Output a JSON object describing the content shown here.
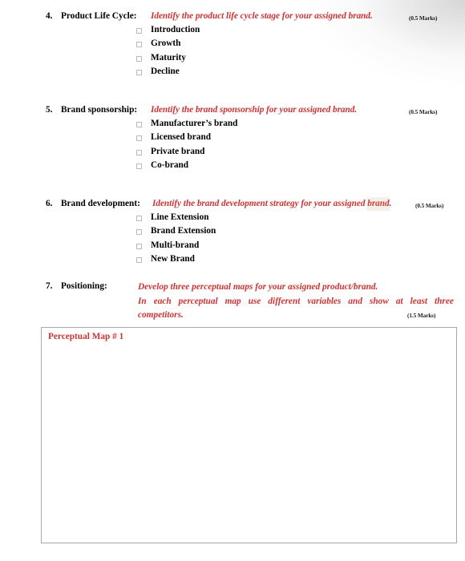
{
  "document": {
    "type": "assignment-worksheet",
    "accent_red": "#CC3333",
    "text_black": "#000000",
    "box_border": "#a8a8a8",
    "checkbox_border": "#b9b9b9"
  },
  "sections": [
    {
      "number": "4.",
      "label": "Product Life Cycle:",
      "instruction": "Identify the product life cycle stage for your assigned brand.",
      "marks": "(0.5 Marks)",
      "options": [
        {
          "label": "Introduction",
          "checked": false
        },
        {
          "label": "Growth",
          "checked": false
        },
        {
          "label": "Maturity",
          "checked": false
        },
        {
          "label": "Decline",
          "checked": false
        }
      ]
    },
    {
      "number": "5.",
      "label": "Brand sponsorship:",
      "instruction": "Identify the brand sponsorship for your assigned brand.",
      "marks": "(0.5 Marks)",
      "options": [
        {
          "label": "Manufacturer’s brand",
          "checked": false
        },
        {
          "label": "Licensed brand",
          "checked": false
        },
        {
          "label": "Private brand",
          "checked": false
        },
        {
          "label": "Co-brand",
          "checked": false
        }
      ]
    },
    {
      "number": "6.",
      "label": "Brand development:",
      "instruction_pre": "Identify the brand development strategy for your assigned ",
      "instruction_marked": "brand",
      "instruction_post": ".",
      "marks": "(0.5 Marks)",
      "options": [
        {
          "label": "Line Extension",
          "checked": false
        },
        {
          "label": "Brand Extension",
          "checked": false
        },
        {
          "label": "Multi-brand",
          "checked": false
        },
        {
          "label": "New Brand",
          "checked": false
        }
      ]
    },
    {
      "number": "7.",
      "label": "Positioning:",
      "marks": "(1.5 Marks)",
      "paragraph": {
        "line1": "Develop three perceptual maps for your assigned product/brand.",
        "line2_words": [
          "In",
          "each",
          "perceptual",
          "map",
          "use",
          "different",
          "variables",
          "and",
          "show",
          "at",
          "least",
          "three"
        ],
        "line3": "competitors."
      }
    }
  ],
  "answer_box": {
    "title": "Perceptual Map # 1"
  }
}
